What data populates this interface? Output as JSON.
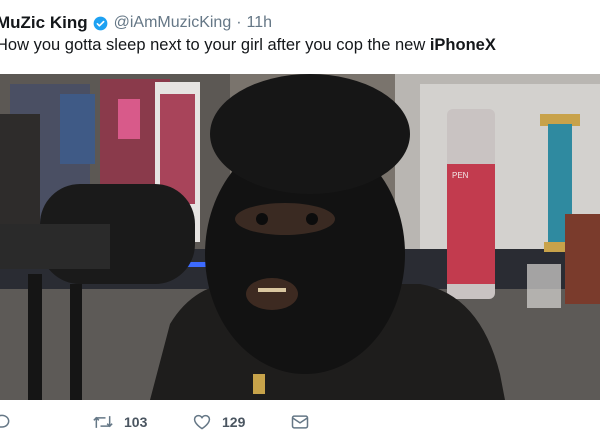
{
  "tweet": {
    "display_name": "MuZic King",
    "handle": "@iAmMuzicKing",
    "separator": "·",
    "time": "11h",
    "text_before": "How you gotta sleep next to your girl after you cop the new ",
    "text_bold": "iPhoneX"
  },
  "actions": {
    "retweets": "103",
    "likes": "129"
  },
  "media": {
    "bottle_label": "PEN"
  },
  "colors": {
    "verified": "#1da1f2",
    "meta": "#657786",
    "text": "#14171a"
  },
  "icons": [
    "verified-badge-icon",
    "reply-icon",
    "retweet-icon",
    "like-icon",
    "dm-icon"
  ]
}
